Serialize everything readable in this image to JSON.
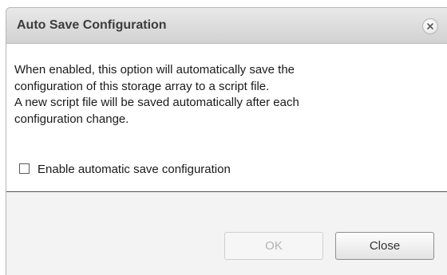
{
  "dialog": {
    "title": "Auto Save Configuration",
    "close_icon": "close-x-icon",
    "description": {
      "line1": "When enabled, this option will automatically save the",
      "line2": "configuration of this storage array to a script file.",
      "line3": "A new script file will be saved automatically after each",
      "line4": "configuration change."
    },
    "checkbox": {
      "label": "Enable automatic save configuration",
      "checked": false
    },
    "buttons": {
      "ok_label": "OK",
      "ok_enabled": false,
      "close_label": "Close"
    }
  }
}
